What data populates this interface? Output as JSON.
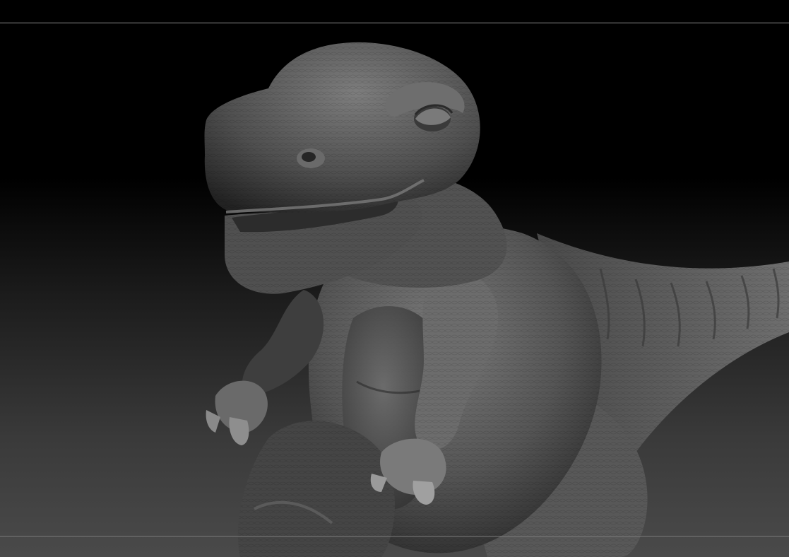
{
  "viewport": {
    "background_top_color": "#000000",
    "background_bottom_color": "#4a4a4a",
    "frame_line_color": "#8d8d8d"
  },
  "model": {
    "subject": "dinosaur-sculpt",
    "material_color": "#5a5a5a",
    "highlight_color": "#8a8a8a",
    "shadow_color": "#1e1e1e"
  }
}
